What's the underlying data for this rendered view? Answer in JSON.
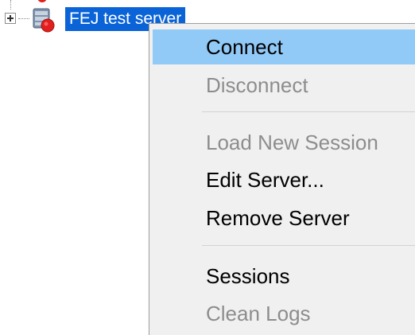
{
  "tree": {
    "node": {
      "label": "FEJ test server",
      "icon": "database-server-error-icon",
      "expanded": false,
      "selected": true
    }
  },
  "context_menu": {
    "highlighted_item": "connect",
    "items": [
      {
        "id": "connect",
        "label": "Connect",
        "enabled": true
      },
      {
        "id": "disconnect",
        "label": "Disconnect",
        "enabled": false
      },
      {
        "id": "load-new-session",
        "label": "Load New Session",
        "enabled": false
      },
      {
        "id": "edit-server",
        "label": "Edit Server...",
        "enabled": true
      },
      {
        "id": "remove-server",
        "label": "Remove Server",
        "enabled": true
      },
      {
        "id": "sessions",
        "label": "Sessions",
        "enabled": true
      },
      {
        "id": "clean-logs",
        "label": "Clean Logs",
        "enabled": false
      }
    ]
  },
  "colors": {
    "selection": "#0a64d8",
    "menu_background": "#f0f0f0",
    "menu_highlight": "#91c9f7",
    "disabled_text": "#8d8d8d"
  }
}
